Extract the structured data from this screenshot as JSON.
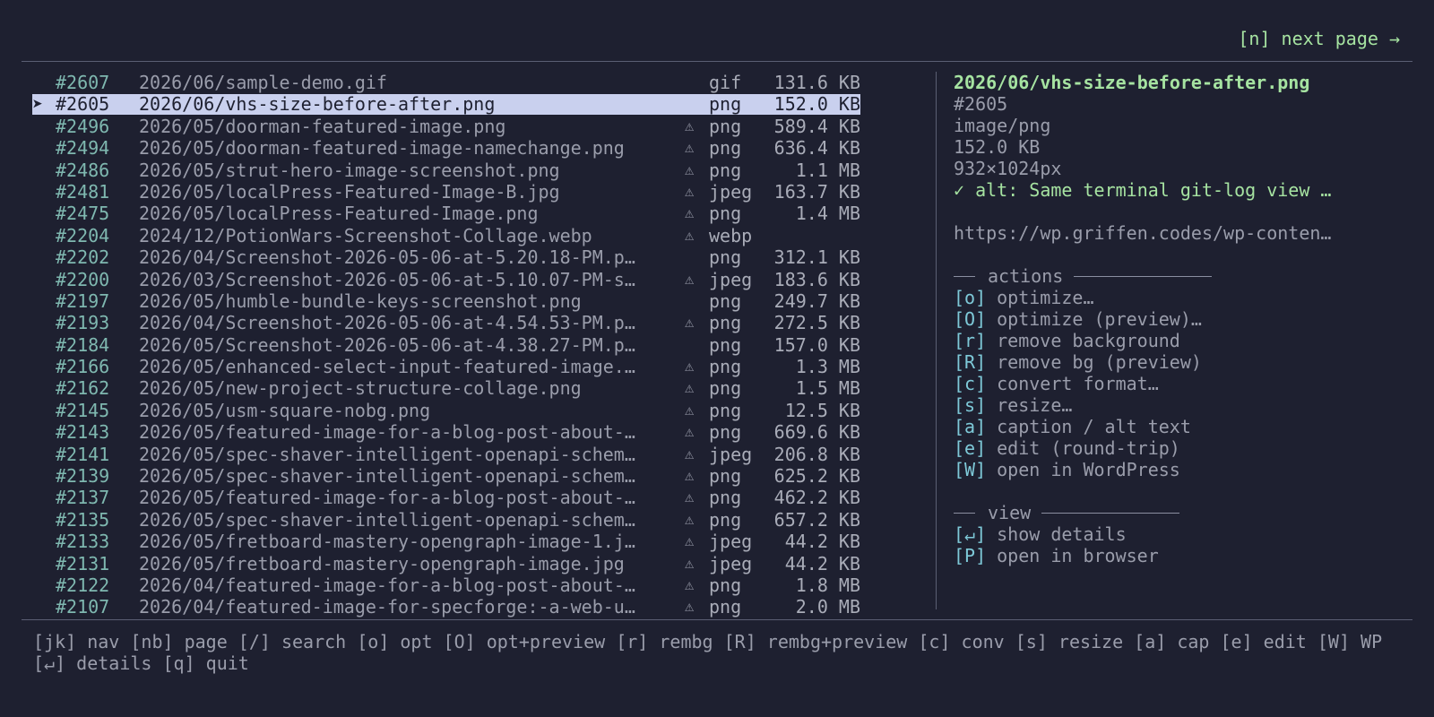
{
  "header": {
    "next_page": "[n] next page →"
  },
  "files": [
    {
      "id": "#2607",
      "path": "2026/06/sample-demo.gif",
      "warn": "",
      "ext": "gif",
      "size": "131.6 KB"
    },
    {
      "id": "#2605",
      "path": "2026/06/vhs-size-before-after.png",
      "warn": "",
      "ext": "png",
      "size": "152.0 KB",
      "selected": true
    },
    {
      "id": "#2496",
      "path": "2026/05/doorman-featured-image.png",
      "warn": "⚠",
      "ext": "png",
      "size": "589.4 KB"
    },
    {
      "id": "#2494",
      "path": "2026/05/doorman-featured-image-namechange.png",
      "warn": "⚠",
      "ext": "png",
      "size": "636.4 KB"
    },
    {
      "id": "#2486",
      "path": "2026/05/strut-hero-image-screenshot.png",
      "warn": "⚠",
      "ext": "png",
      "size": "1.1 MB"
    },
    {
      "id": "#2481",
      "path": "2026/05/localPress-Featured-Image-B.jpg",
      "warn": "⚠",
      "ext": "jpeg",
      "size": "163.7 KB"
    },
    {
      "id": "#2475",
      "path": "2026/05/localPress-Featured-Image.png",
      "warn": "⚠",
      "ext": "png",
      "size": "1.4 MB"
    },
    {
      "id": "#2204",
      "path": "2024/12/PotionWars-Screenshot-Collage.webp",
      "warn": "⚠",
      "ext": "webp",
      "size": ""
    },
    {
      "id": "#2202",
      "path": "2026/04/Screenshot-2026-05-06-at-5.20.18-PM.p…",
      "warn": "",
      "ext": "png",
      "size": "312.1 KB"
    },
    {
      "id": "#2200",
      "path": "2026/03/Screenshot-2026-05-06-at-5.10.07-PM-s…",
      "warn": "⚠",
      "ext": "jpeg",
      "size": "183.6 KB"
    },
    {
      "id": "#2197",
      "path": "2026/05/humble-bundle-keys-screenshot.png",
      "warn": "",
      "ext": "png",
      "size": "249.7 KB"
    },
    {
      "id": "#2193",
      "path": "2026/04/Screenshot-2026-05-06-at-4.54.53-PM.p…",
      "warn": "⚠",
      "ext": "png",
      "size": "272.5 KB"
    },
    {
      "id": "#2184",
      "path": "2026/05/Screenshot-2026-05-06-at-4.38.27-PM.p…",
      "warn": "",
      "ext": "png",
      "size": "157.0 KB"
    },
    {
      "id": "#2166",
      "path": "2026/05/enhanced-select-input-featured-image.…",
      "warn": "⚠",
      "ext": "png",
      "size": "1.3 MB"
    },
    {
      "id": "#2162",
      "path": "2026/05/new-project-structure-collage.png",
      "warn": "⚠",
      "ext": "png",
      "size": "1.5 MB"
    },
    {
      "id": "#2145",
      "path": "2026/05/usm-square-nobg.png",
      "warn": "⚠",
      "ext": "png",
      "size": "12.5 KB"
    },
    {
      "id": "#2143",
      "path": "2026/05/featured-image-for-a-blog-post-about-…",
      "warn": "⚠",
      "ext": "png",
      "size": "669.6 KB"
    },
    {
      "id": "#2141",
      "path": "2026/05/spec-shaver-intelligent-openapi-schem…",
      "warn": "⚠",
      "ext": "jpeg",
      "size": "206.8 KB"
    },
    {
      "id": "#2139",
      "path": "2026/05/spec-shaver-intelligent-openapi-schem…",
      "warn": "⚠",
      "ext": "png",
      "size": "625.2 KB"
    },
    {
      "id": "#2137",
      "path": "2026/05/featured-image-for-a-blog-post-about-…",
      "warn": "⚠",
      "ext": "png",
      "size": "462.2 KB"
    },
    {
      "id": "#2135",
      "path": "2026/05/spec-shaver-intelligent-openapi-schem…",
      "warn": "⚠",
      "ext": "png",
      "size": "657.2 KB"
    },
    {
      "id": "#2133",
      "path": "2026/05/fretboard-mastery-opengraph-image-1.j…",
      "warn": "⚠",
      "ext": "jpeg",
      "size": "44.2 KB"
    },
    {
      "id": "#2131",
      "path": "2026/05/fretboard-mastery-opengraph-image.jpg",
      "warn": "⚠",
      "ext": "jpeg",
      "size": "44.2 KB"
    },
    {
      "id": "#2122",
      "path": "2026/04/featured-image-for-a-blog-post-about-…",
      "warn": "⚠",
      "ext": "png",
      "size": "1.8 MB"
    },
    {
      "id": "#2107",
      "path": "2026/04/featured-image-for-specforge:-a-web-u…",
      "warn": "⚠",
      "ext": "png",
      "size": "2.0 MB"
    }
  ],
  "selection_caret": "➤",
  "details": {
    "title": "2026/06/vhs-size-before-after.png",
    "id": "#2605",
    "mime": "image/png",
    "size": "152.0 KB",
    "dimensions": "932×1024px",
    "alt": "✓ alt: Same terminal git-log view …",
    "url": "https://wp.griffen.codes/wp-conten…"
  },
  "actions": {
    "heading": "actions",
    "items": [
      {
        "key": "[o]",
        "label": "optimize…"
      },
      {
        "key": "[O]",
        "label": "optimize (preview)…"
      },
      {
        "key": "[r]",
        "label": "remove background"
      },
      {
        "key": "[R]",
        "label": "remove bg (preview)"
      },
      {
        "key": "[c]",
        "label": "convert format…"
      },
      {
        "key": "[s]",
        "label": "resize…"
      },
      {
        "key": "[a]",
        "label": "caption / alt text"
      },
      {
        "key": "[e]",
        "label": "edit (round-trip)"
      },
      {
        "key": "[W]",
        "label": "open in WordPress"
      }
    ]
  },
  "view": {
    "heading": "view",
    "items": [
      {
        "key": "[↵]",
        "label": "show details"
      },
      {
        "key": "[P]",
        "label": "open in browser"
      }
    ]
  },
  "footer": "[jk] nav [nb] page [/] search [o] opt [O] opt+preview [r] rembg [R] rembg+preview [c] conv [s] resize [a] cap [e] edit [W] WP [↵] details [q] quit",
  "colors": {
    "background": "#1e2030",
    "accent_green": "#a6e3a1",
    "id_teal": "#7fb8b0",
    "key_cyan": "#7ec9d8",
    "selection_bg": "#c9d0ee"
  }
}
